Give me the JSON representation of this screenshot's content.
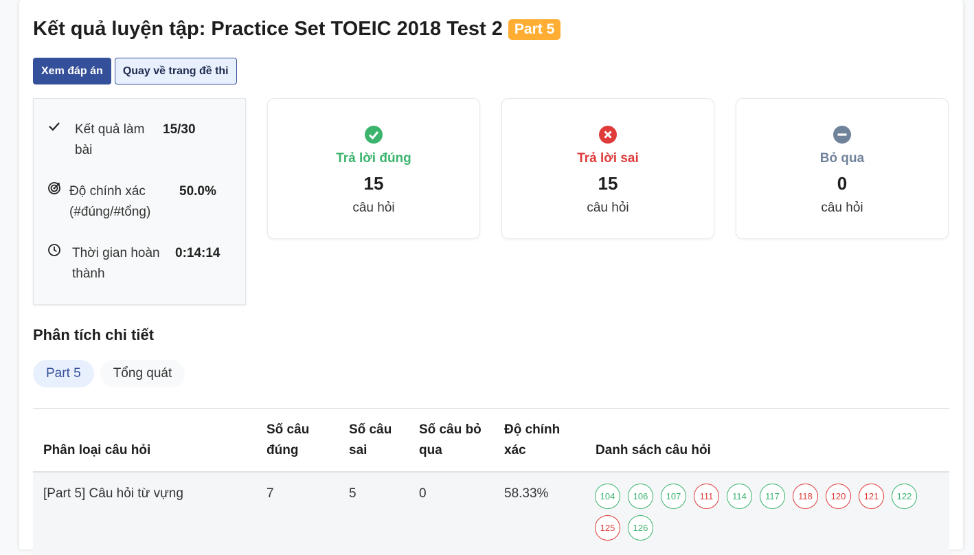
{
  "header": {
    "title": "Kết quả luyện tập: Practice Set TOEIC 2018 Test 2",
    "badge": "Part 5"
  },
  "actions": {
    "view_answers": "Xem đáp án",
    "back": "Quay về trang đề thi"
  },
  "summary": {
    "result_label": "Kết quả làm bài",
    "result_value": "15/30",
    "accuracy_label": "Độ chính xác (#đúng/#tổng)",
    "accuracy_value": "50.0%",
    "time_label": "Thời gian hoàn thành",
    "time_value": "0:14:14"
  },
  "stats": {
    "correct": {
      "label": "Trả lời đúng",
      "value": "15",
      "unit": "câu hỏi",
      "color": "#3cb46e",
      "icon": "check-circle-icon"
    },
    "wrong": {
      "label": "Trả lời sai",
      "value": "15",
      "unit": "câu hỏi",
      "color": "#e03b3b",
      "icon": "x-circle-icon"
    },
    "skipped": {
      "label": "Bỏ qua",
      "value": "0",
      "unit": "câu hỏi",
      "color": "#71839b",
      "icon": "minus-circle-icon"
    }
  },
  "analysis": {
    "title": "Phân tích chi tiết",
    "tabs": [
      "Part 5",
      "Tổng quát"
    ]
  },
  "table": {
    "headers": {
      "type": "Phân loại câu hỏi",
      "correct": "Số câu đúng",
      "wrong": "Số câu sai",
      "skipped": "Số câu bỏ qua",
      "accuracy": "Độ chính xác",
      "questions": "Danh sách câu hỏi"
    },
    "rows": [
      {
        "type": "[Part 5] Câu hỏi từ vựng",
        "correct": "7",
        "wrong": "5",
        "skipped": "0",
        "accuracy": "58.33%",
        "questions": [
          {
            "num": "104",
            "status": "correct"
          },
          {
            "num": "106",
            "status": "correct"
          },
          {
            "num": "107",
            "status": "correct"
          },
          {
            "num": "111",
            "status": "wrong"
          },
          {
            "num": "114",
            "status": "correct"
          },
          {
            "num": "117",
            "status": "correct"
          },
          {
            "num": "118",
            "status": "wrong"
          },
          {
            "num": "120",
            "status": "wrong"
          },
          {
            "num": "121",
            "status": "wrong"
          },
          {
            "num": "122",
            "status": "correct"
          },
          {
            "num": "125",
            "status": "wrong"
          },
          {
            "num": "126",
            "status": "correct"
          }
        ]
      }
    ]
  }
}
